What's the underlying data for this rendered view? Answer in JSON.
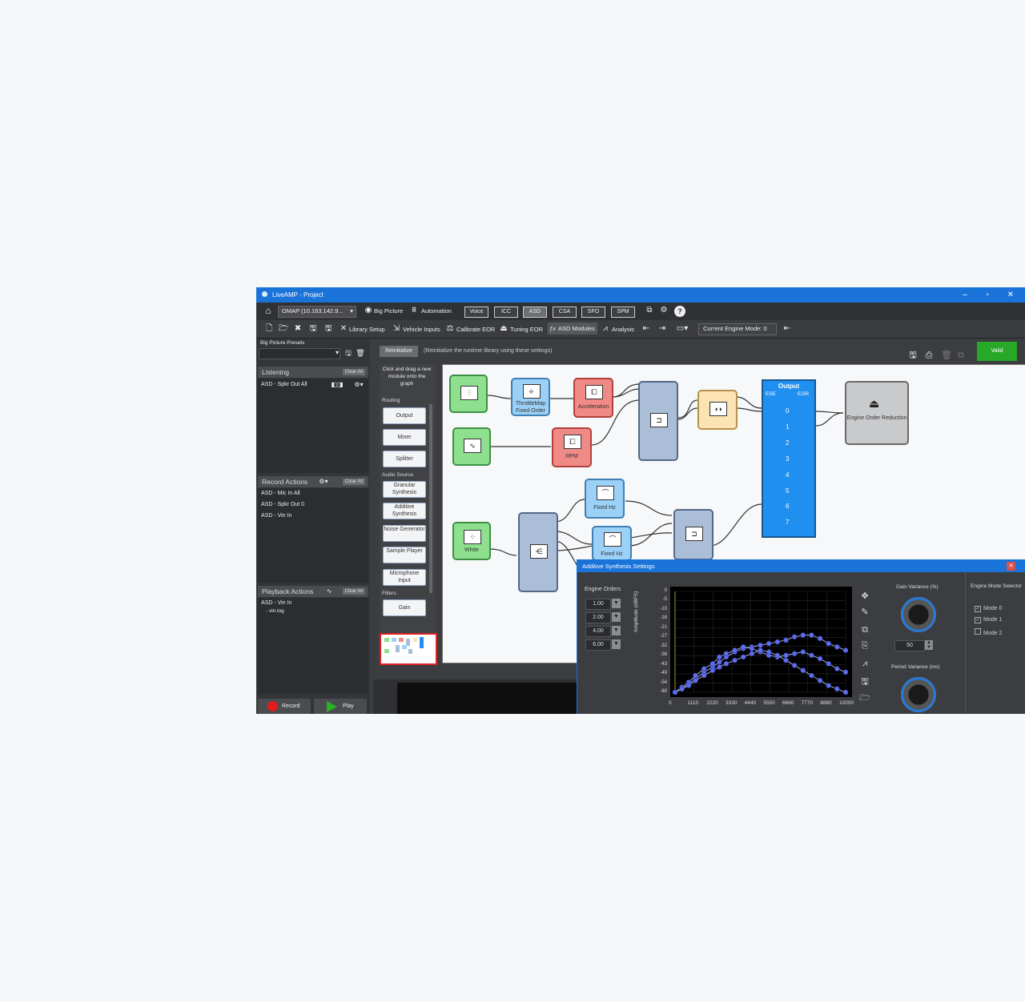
{
  "window": {
    "title": "LiveAMP - Project"
  },
  "toolbar1": {
    "omap": "OMAP (10.163.142.9...",
    "big_picture": "Big Picture",
    "automation": "Automation",
    "modes": [
      "Voice",
      "ICC",
      "ASD",
      "CSA",
      "SFO",
      "SPM"
    ],
    "selected_mode": "ASD"
  },
  "toolbar2": {
    "library_setup": "Library Setup",
    "vehicle_inputs": "Vehicle Inputs",
    "calibrate_eor": "Calibrate EOR",
    "tuning_eor": "Tuning EOR",
    "asd_modules": "ASD Modules",
    "analysis": "Analysis",
    "engine_mode": "Current Engine Mode: 0"
  },
  "left": {
    "presets_label": "Big Picture Presets",
    "listening_title": "Listening",
    "listening_item": "ASD - Spkr Out All",
    "clear_all": "Clear All",
    "record_title": "Record Actions",
    "record_items": [
      "ASD - Mic In All",
      "ASD - Spkr Out 0",
      "ASD - Vin In"
    ],
    "playback_title": "Playback Actions",
    "playback_items": [
      "ASD - Vin In",
      "- vin.log"
    ],
    "record_btn": "Record",
    "play_btn": "Play"
  },
  "header": {
    "reinitialize": "Reinitialize",
    "reinit_hint": "(Reinitialize the runtime library using these settings)",
    "valid": "Valid"
  },
  "palette": {
    "hint": "Click and drag a new module onto the graph",
    "routing": "Routing",
    "routing_items": [
      "Output",
      "Mixer",
      "Splitter"
    ],
    "audio_source": "Audio Source",
    "audio_items": [
      "Granular Synthesis",
      "Additive Synthesis",
      "Noise Generator",
      "Sample Player",
      "Microphone Input"
    ],
    "filters": "Filters",
    "filter_items": [
      "Gain"
    ]
  },
  "graph": {
    "throttle": "ThrottleMap Fixed Order",
    "acceleration": "Acceleration",
    "rpm": "RPM",
    "white": "White",
    "fixed_hz_1": "Fixed Hz",
    "fixed_hz_2": "Fixed Hz",
    "output_title": "Output",
    "output_ese": "ESE",
    "output_eor": "EOR",
    "output_channels": [
      "0",
      "1",
      "2",
      "3",
      "4",
      "5",
      "6",
      "7"
    ],
    "eor_node": "Engine Order Reduction"
  },
  "dialog": {
    "title": "Additive Synthesis Settings",
    "engine_orders_label": "Engine Orders",
    "engine_orders": [
      "1.00",
      "2.00",
      "4.00",
      "6.00"
    ],
    "ylabel": "Amplitude (dBFS)",
    "yticks": [
      "0",
      "-5",
      "-10",
      "-16",
      "-21",
      "-27",
      "-32",
      "-38",
      "-43",
      "-49",
      "-54",
      "-60"
    ],
    "xticks": [
      "0",
      "1110",
      "2220",
      "3330",
      "4440",
      "5550",
      "6660",
      "7770",
      "8880",
      "10000"
    ],
    "gain_variance_label": "Gain Variance (%)",
    "gain_variance_value": "50",
    "period_variance_label": "Period Variance (ms)",
    "engine_mode_selector": "Engine Mode Selector",
    "modes": [
      {
        "label": "Mode 0",
        "checked": true
      },
      {
        "label": "Mode 1",
        "checked": true
      },
      {
        "label": "Mode 2",
        "checked": false
      }
    ]
  },
  "chart_data": {
    "type": "line",
    "ylabel": "Amplitude (dBFS)",
    "xlim": [
      0,
      10000
    ],
    "ylim": [
      -60,
      0
    ],
    "series": [
      {
        "x": [
          0,
          400,
          800,
          1200,
          1700,
          2200,
          2600,
          3000,
          3500,
          4000,
          4500,
          5000,
          5500,
          6000,
          6500,
          7000,
          7500,
          8000,
          8500,
          9000,
          9500,
          10000
        ],
        "values": [
          -60,
          -58,
          -55,
          -52,
          -48,
          -45,
          -42,
          -39,
          -36,
          -34,
          -33,
          -32,
          -31,
          -30,
          -29,
          -27,
          -26,
          -26,
          -28,
          -31,
          -33,
          -35
        ]
      },
      {
        "x": [
          0,
          400,
          800,
          1200,
          1700,
          2200,
          2600,
          3000,
          3500,
          4000,
          4500,
          5000,
          5500,
          6000,
          6500,
          7000,
          7500,
          8000,
          8500,
          9000,
          9500,
          10000
        ],
        "values": [
          -60,
          -57,
          -54,
          -50,
          -46,
          -43,
          -39,
          -37,
          -35,
          -33,
          -34,
          -36,
          -38,
          -39,
          -38,
          -37,
          -36,
          -38,
          -40,
          -43,
          -46,
          -48
        ]
      },
      {
        "x": [
          0,
          400,
          800,
          1200,
          1700,
          2200,
          2600,
          3000,
          3500,
          4000,
          4500,
          5000,
          5500,
          6000,
          6500,
          7000,
          7500,
          8000,
          8500,
          9000,
          9500,
          10000
        ],
        "values": [
          -60,
          -58,
          -56,
          -53,
          -50,
          -47,
          -45,
          -43,
          -41,
          -39,
          -37,
          -35,
          -36,
          -38,
          -41,
          -44,
          -47,
          -50,
          -53,
          -56,
          -58,
          -60
        ]
      }
    ]
  }
}
